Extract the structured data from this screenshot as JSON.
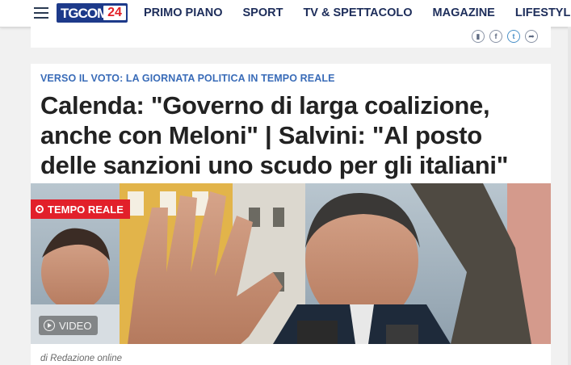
{
  "header": {
    "logo_text": "TGCOM",
    "logo_number": "24",
    "nav_items": [
      "PRIMO PIANO",
      "SPORT",
      "TV & SPETTACOLO",
      "MAGAZINE",
      "LIFESTYLE"
    ]
  },
  "share": {
    "icons": [
      "bookmark-icon",
      "facebook-icon",
      "twitter-icon",
      "share-icon"
    ],
    "glyphs": [
      "▮",
      "f",
      "t",
      "➦"
    ]
  },
  "article": {
    "kicker": "VERSO IL VOTO: LA GIORNATA POLITICA IN TEMPO REALE",
    "headline": "Calenda: \"Governo di larga coalizione, anche con Meloni\" | Salvini: \"Al posto delle sanzioni uno scudo per gli italiani\"",
    "live_badge": "TEMPO REALE",
    "video_label": "VIDEO",
    "byline": "di Redazione online"
  },
  "colors": {
    "brand_blue": "#1d3a8a",
    "live_red": "#e2202a",
    "kicker_blue": "#3a6cb8"
  }
}
